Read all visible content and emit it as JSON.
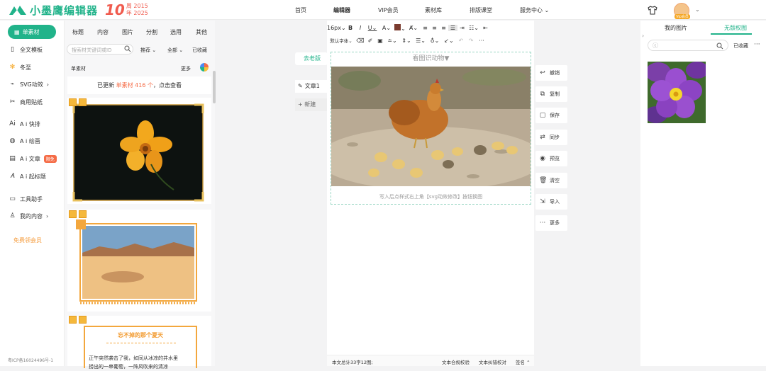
{
  "header": {
    "logo_text": "小墨鹰编辑器",
    "badge_number": "10",
    "badge_line1": "周 2015",
    "badge_line2": "年 2025",
    "nav": [
      "首页",
      "编辑器",
      "VIP会员",
      "素材库",
      "排版课堂",
      "服务中心"
    ],
    "avatar_badge": "Vip会员"
  },
  "left_menu": {
    "active": "单素材",
    "items": [
      "全文模板",
      "冬至",
      "SVG动效",
      "商用贴纸",
      "A i 快排",
      "A i 绘画",
      "A i 文章",
      "A i 起标题",
      "工具助手",
      "我的内容"
    ],
    "hot_badge": "限免",
    "free_vip": "免费领会员",
    "icp": "粤ICP备16024496号-1"
  },
  "materials": {
    "tabs": [
      "标题",
      "内容",
      "图片",
      "分割",
      "选用",
      "其他"
    ],
    "search_placeholder": "搜索材关键词或ID",
    "filters": [
      "推荐",
      "全部",
      "已收藏"
    ],
    "header_title": "单素材",
    "header_more": "更多",
    "update_prefix": "已更新 ",
    "update_highlight": "单素材 416 个",
    "update_suffix": "，点击查看",
    "card3_title": "忘不掉的那个夏天",
    "card3_text_line1": "正午突然袭击了我，如同从冰凉的井水里",
    "card3_text_line2": "捞出的一串葡萄，一阵风吹来的清凉"
  },
  "editor": {
    "side_prev": "去老版",
    "article": "文章1",
    "new": "新建",
    "font_size": "16px",
    "font_family": "默认字体",
    "image_label": "看图识动物▼",
    "hint": "写入后点样式右上角【svg动效修改】按钮换图",
    "status_words": "本文总计33字12图;",
    "status_check1": "文本合规校验",
    "status_check2": "文本纠错校对",
    "status_sign": "签名"
  },
  "actions": [
    "撤销",
    "复制",
    "保存",
    "同步",
    "预览",
    "清空",
    "导入",
    "更多"
  ],
  "right_panel": {
    "tabs": [
      "我的图片",
      "无版权图"
    ],
    "collected": "已收藏",
    "more": "···"
  },
  "colors": {
    "brand": "#21b38a",
    "accent": "#f56c47",
    "gold": "#f5b83b"
  }
}
